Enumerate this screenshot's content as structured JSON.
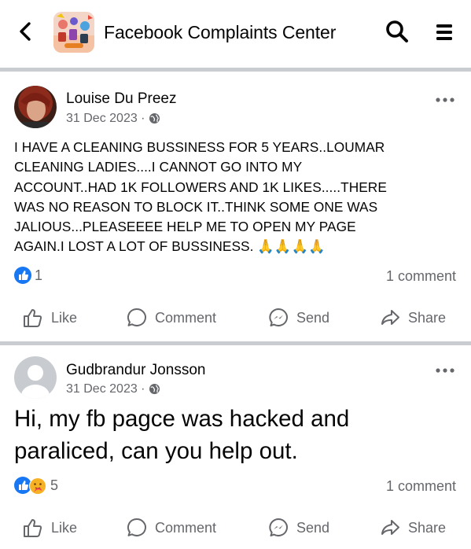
{
  "header": {
    "title": "Facebook Complaints Center",
    "icons": [
      "back-arrow-icon",
      "group-avatar",
      "search-icon",
      "menu-icon"
    ]
  },
  "posts": [
    {
      "author": "Louise Du Preez",
      "date": "31 Dec 2023 ·",
      "privacy_icon": "globe-icon",
      "text": "I HAVE A CLEANING BUSSINESS FOR 5 YEARS..LOUMAR\nCLEANING LADIES....I CANNOT GO INTO MY\nACCOUNT..HAD 1K FOLLOWERS AND 1K LIKES.....THERE\nWAS NO REASON TO BLOCK IT..THINK SOME ONE WAS\nJALIOUS...PLEASEEEE HELP ME TO OPEN MY PAGE\nAGAIN.I LOST A LOT OF BUSSINESS.",
      "emoji": "🙏🙏🙏🙏",
      "reactions": [
        "like"
      ],
      "reaction_count": "1",
      "comments": "1 comment"
    },
    {
      "author": "Gudbrandur Jonsson",
      "date": "31 Dec 2023 ·",
      "privacy_icon": "globe-icon",
      "text": "Hi, my fb pagce was hacked and\nparaliced, can you help out.",
      "reactions": [
        "like",
        "care"
      ],
      "reaction_count": "5",
      "comments": "1 comment"
    }
  ],
  "actions": {
    "like": "Like",
    "comment": "Comment",
    "send": "Send",
    "share": "Share"
  },
  "colors": {
    "separator": "#c9ccd1",
    "secondary_text": "#65676b",
    "like_blue": "#1877f2"
  }
}
